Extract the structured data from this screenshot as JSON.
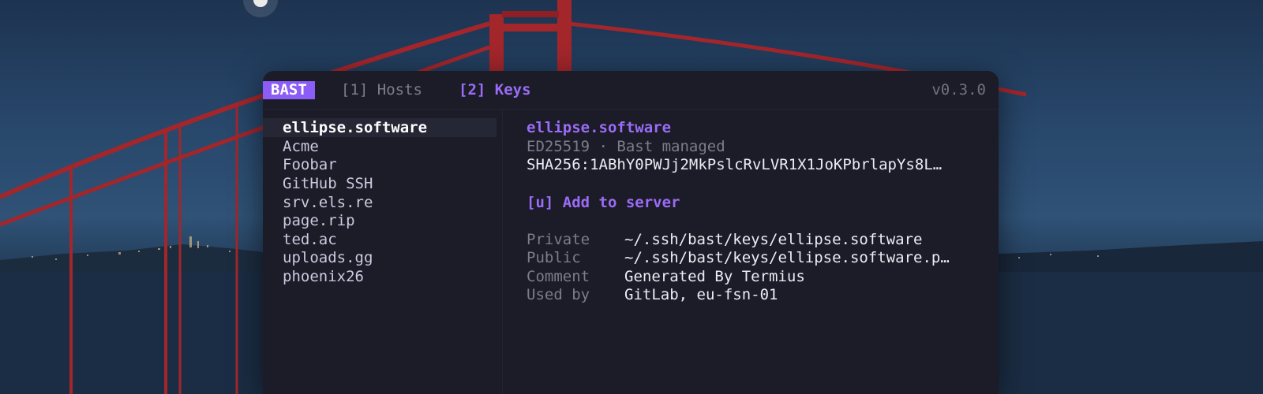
{
  "app": {
    "badge": "BAST",
    "version": "v0.3.0"
  },
  "tabs": [
    {
      "label": "[1] Hosts",
      "active": false
    },
    {
      "label": "[2] Keys",
      "active": true
    }
  ],
  "key_list": {
    "items": [
      {
        "label": "ellipse.software",
        "selected": true
      },
      {
        "label": "Acme",
        "selected": false
      },
      {
        "label": "Foobar",
        "selected": false
      },
      {
        "label": "GitHub SSH",
        "selected": false
      },
      {
        "label": "srv.els.re",
        "selected": false
      },
      {
        "label": "page.rip",
        "selected": false
      },
      {
        "label": "ted.ac",
        "selected": false
      },
      {
        "label": "uploads.gg",
        "selected": false
      },
      {
        "label": "phoenix26",
        "selected": false
      }
    ]
  },
  "details": {
    "title": "ellipse.software",
    "type": "ED25519 · Bast managed",
    "fingerprint": "SHA256:1ABhY0PWJj2MkPslcRvLVR1X1JoKPbrlapYs8L…",
    "action": "[u] Add to server",
    "fields": {
      "private_label": "Private",
      "private_value": "~/.ssh/bast/keys/ellipse.software",
      "public_label": "Public",
      "public_value": "~/.ssh/bast/keys/ellipse.software.p…",
      "comment_label": "Comment",
      "comment_value": "Generated By Termius",
      "usedby_label": "Used by",
      "usedby_value": "GitLab, eu-fsn-01"
    }
  },
  "colors": {
    "accent": "#8b5cf6",
    "window_bg": "#1b1c27",
    "muted": "#7b7d8c",
    "bridge_red": "#a3262b"
  }
}
